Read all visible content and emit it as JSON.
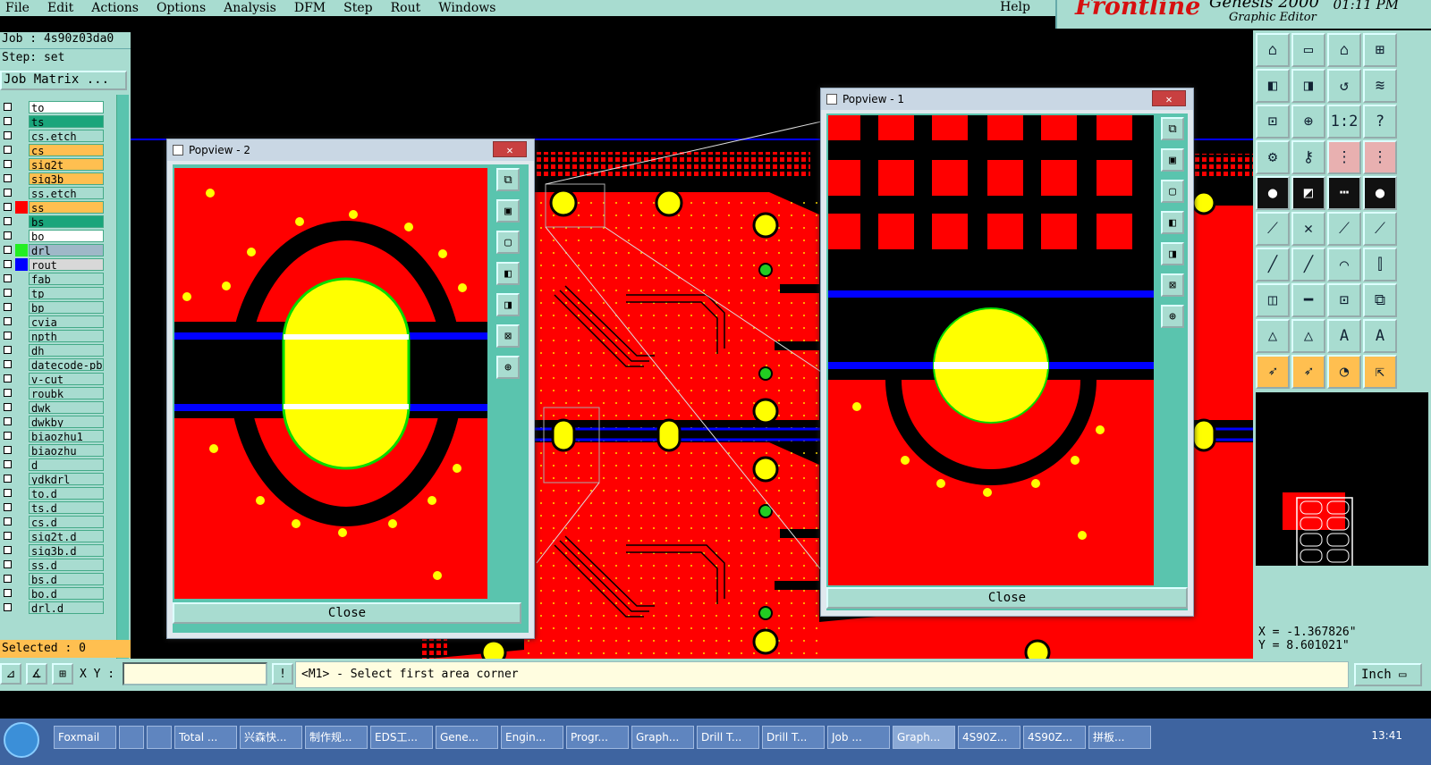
{
  "menu": {
    "items": [
      "File",
      "Edit",
      "Actions",
      "Options",
      "Analysis",
      "DFM",
      "Step",
      "Rout",
      "Windows"
    ],
    "help": "Help"
  },
  "brand": {
    "logo": "Frontline",
    "product": "Genesis 2000",
    "subtitle": "Graphic Editor",
    "clock": "01:11 PM"
  },
  "job": {
    "label": "Job : 4s90z03da0",
    "step": "Step: set",
    "matrix_button": "Job Matrix ..."
  },
  "layers": [
    {
      "name": "to",
      "color": "#ffffff"
    },
    {
      "name": "ts",
      "color": "#1aa57b"
    },
    {
      "name": "cs.etch",
      "color": "#a8dcd0"
    },
    {
      "name": "cs",
      "color": "#ffbf50"
    },
    {
      "name": "sig2t",
      "color": "#ffbf50"
    },
    {
      "name": "sig3b",
      "color": "#ffbf50"
    },
    {
      "name": "ss.etch",
      "color": "#a8dcd0"
    },
    {
      "name": "ss",
      "color": "#ffbf50",
      "swatch": "#ff0000"
    },
    {
      "name": "bs",
      "color": "#1aa57b"
    },
    {
      "name": "bo",
      "color": "#ffffff"
    },
    {
      "name": "drl",
      "color": "#9fb8c8",
      "swatch": "#22ee22"
    },
    {
      "name": "rout",
      "color": "#d8d8d8",
      "swatch": "#0000ff"
    },
    {
      "name": "fab",
      "color": "#a8dcd0"
    },
    {
      "name": "tp",
      "color": "#a8dcd0"
    },
    {
      "name": "bp",
      "color": "#a8dcd0"
    },
    {
      "name": "cvia",
      "color": "#a8dcd0"
    },
    {
      "name": "npth",
      "color": "#a8dcd0"
    },
    {
      "name": "dh",
      "color": "#a8dcd0"
    },
    {
      "name": "datecode-pbe",
      "color": "#a8dcd0"
    },
    {
      "name": "v-cut",
      "color": "#a8dcd0"
    },
    {
      "name": "roubk",
      "color": "#a8dcd0"
    },
    {
      "name": "dwk",
      "color": "#a8dcd0"
    },
    {
      "name": "dwkby",
      "color": "#a8dcd0"
    },
    {
      "name": "biaozhu1",
      "color": "#a8dcd0"
    },
    {
      "name": "biaozhu",
      "color": "#a8dcd0"
    },
    {
      "name": "d",
      "color": "#a8dcd0"
    },
    {
      "name": "ydkdrl",
      "color": "#a8dcd0"
    },
    {
      "name": "to.d",
      "color": "#a8dcd0"
    },
    {
      "name": "ts.d",
      "color": "#a8dcd0"
    },
    {
      "name": "cs.d",
      "color": "#a8dcd0"
    },
    {
      "name": "sig2t.d",
      "color": "#a8dcd0"
    },
    {
      "name": "sig3b.d",
      "color": "#a8dcd0"
    },
    {
      "name": "ss.d",
      "color": "#a8dcd0"
    },
    {
      "name": "bs.d",
      "color": "#a8dcd0"
    },
    {
      "name": "bo.d",
      "color": "#a8dcd0"
    },
    {
      "name": "drl.d",
      "color": "#a8dcd0"
    }
  ],
  "selected": "Selected : 0",
  "popview1": {
    "title": "Popview - 1",
    "close_label": "Close"
  },
  "popview2": {
    "title": "Popview - 2",
    "close_label": "Close"
  },
  "coords": {
    "x": "X = -1.367826\"",
    "y": "Y = 8.601021\""
  },
  "command": {
    "xy_label": "X Y :",
    "xy_value": "",
    "message": "<M1> - Select first area corner",
    "unit": "Inch"
  },
  "toolbar": [
    {
      "icon": "zoom-home-icon",
      "glyph": "⌂"
    },
    {
      "icon": "zoom-out-icon",
      "glyph": "▭"
    },
    {
      "icon": "home-icon",
      "glyph": "⌂"
    },
    {
      "icon": "grid-icon",
      "glyph": "⊞"
    },
    {
      "icon": "pan-left-icon",
      "glyph": "◧"
    },
    {
      "icon": "pan-right-icon",
      "glyph": "◨"
    },
    {
      "icon": "undo-view-icon",
      "glyph": "↺"
    },
    {
      "icon": "redraw-icon",
      "glyph": "≋"
    },
    {
      "icon": "fit-icon",
      "glyph": "⊡"
    },
    {
      "icon": "center-icon",
      "glyph": "⊕"
    },
    {
      "icon": "scale-icon",
      "glyph": "1:2"
    },
    {
      "icon": "help-icon",
      "glyph": "?"
    },
    {
      "icon": "settings-icon",
      "glyph": "⚙"
    },
    {
      "icon": "key-icon",
      "glyph": "⚷"
    },
    {
      "icon": "net-icon",
      "glyph": "⋮"
    },
    {
      "icon": "net2-icon",
      "glyph": "⋮"
    },
    {
      "icon": "measure-point-icon",
      "glyph": "●"
    },
    {
      "icon": "measure-area-icon",
      "glyph": "◩"
    },
    {
      "icon": "ruler-icon",
      "glyph": "┅"
    },
    {
      "icon": "pad-icon",
      "glyph": "●"
    },
    {
      "icon": "connect-icon",
      "glyph": "⟋"
    },
    {
      "icon": "cross-icon",
      "glyph": "✕"
    },
    {
      "icon": "line-pad-icon",
      "glyph": "⟋"
    },
    {
      "icon": "line-pad2-icon",
      "glyph": "⟋"
    },
    {
      "icon": "line-icon",
      "glyph": "╱"
    },
    {
      "icon": "line2-icon",
      "glyph": "╱"
    },
    {
      "icon": "arc-icon",
      "glyph": "⌒"
    },
    {
      "icon": "text-icon",
      "glyph": "⫿"
    },
    {
      "icon": "shape-icon",
      "glyph": "◫"
    },
    {
      "icon": "dash-icon",
      "glyph": "━"
    },
    {
      "icon": "frame-icon",
      "glyph": "⊡"
    },
    {
      "icon": "blocks-icon",
      "glyph": "⧉"
    },
    {
      "icon": "triangle-icon",
      "glyph": "△"
    },
    {
      "icon": "triangle2-icon",
      "glyph": "△"
    },
    {
      "icon": "text-a-icon",
      "glyph": "A"
    },
    {
      "icon": "text-a2-icon",
      "glyph": "A"
    },
    {
      "icon": "select-arrow-icon",
      "glyph": "➶"
    },
    {
      "icon": "select-arrow2-icon",
      "glyph": "➶"
    },
    {
      "icon": "select-circle-icon",
      "glyph": "◔"
    },
    {
      "icon": "select-move-icon",
      "glyph": "⇱"
    }
  ],
  "popview_tools": [
    {
      "icon": "restore-icon",
      "glyph": "⧉"
    },
    {
      "icon": "zoom-in-icon",
      "glyph": "▣"
    },
    {
      "icon": "zoom-out-icon",
      "glyph": "▢"
    },
    {
      "icon": "pan-left-icon",
      "glyph": "◧"
    },
    {
      "icon": "pan-right-icon",
      "glyph": "◨"
    },
    {
      "icon": "fit-icon",
      "glyph": "⊠"
    },
    {
      "icon": "center-icon",
      "glyph": "⊕"
    }
  ],
  "taskbar": {
    "items": [
      "Foxmail",
      "",
      "",
      "Total ...",
      "兴森快...",
      "制作规...",
      "EDS工...",
      "Gene...",
      "Engin...",
      "Progr...",
      "Graph...",
      "Drill T...",
      "Drill T...",
      "Job ...",
      "Graph...",
      "4S90Z...",
      "4S90Z...",
      "拼板..."
    ],
    "time": "13:41"
  },
  "colors": {
    "panel": "#a8dcd0",
    "copper": "#ff0000",
    "drill": "#ffff00",
    "route": "#0000ff",
    "selected": "#ffbf50"
  }
}
